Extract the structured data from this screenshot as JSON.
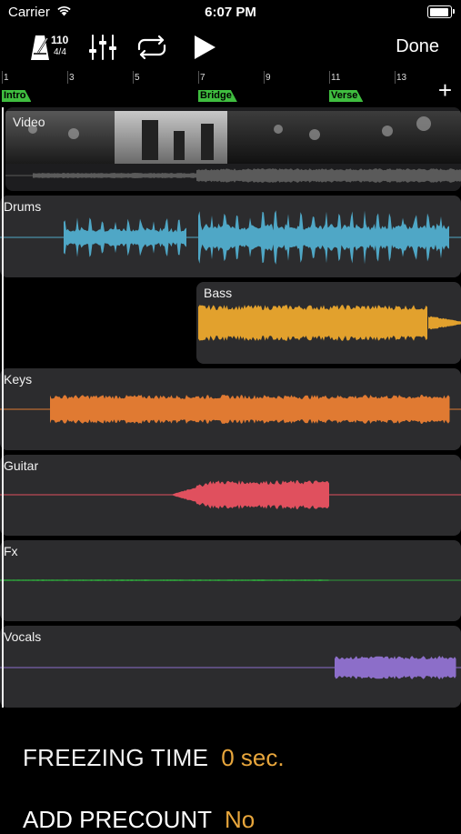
{
  "status_bar": {
    "carrier": "Carrier",
    "time": "6:07 PM"
  },
  "toolbar": {
    "tempo": "110",
    "time_signature": "4/4",
    "icons": [
      "metronome-icon",
      "mixer-icon",
      "loop-icon",
      "play-icon"
    ],
    "done_label": "Done"
  },
  "ruler": {
    "bars": [
      "1",
      "3",
      "5",
      "7",
      "9",
      "11",
      "13"
    ],
    "markers": [
      {
        "label": "Intro",
        "bar": 1
      },
      {
        "label": "Bridge",
        "bar": 7
      },
      {
        "label": "Verse",
        "bar": 11
      }
    ],
    "add_icon": "plus-icon"
  },
  "tracks": [
    {
      "name": "Video",
      "color": "#8a8a8a"
    },
    {
      "name": "Drums",
      "color": "#4fa7c6"
    },
    {
      "name": "Bass",
      "color": "#e2a12d"
    },
    {
      "name": "Keys",
      "color": "#e07a32"
    },
    {
      "name": "Guitar",
      "color": "#e0505e"
    },
    {
      "name": "Fx",
      "color": "#2e9a3a"
    },
    {
      "name": "Vocals",
      "color": "#8c6ec9"
    }
  ],
  "settings": {
    "freeze_label": "FREEZING TIME",
    "freeze_value": "0 sec.",
    "precount_label": "ADD PRECOUNT",
    "precount_value": "No"
  }
}
